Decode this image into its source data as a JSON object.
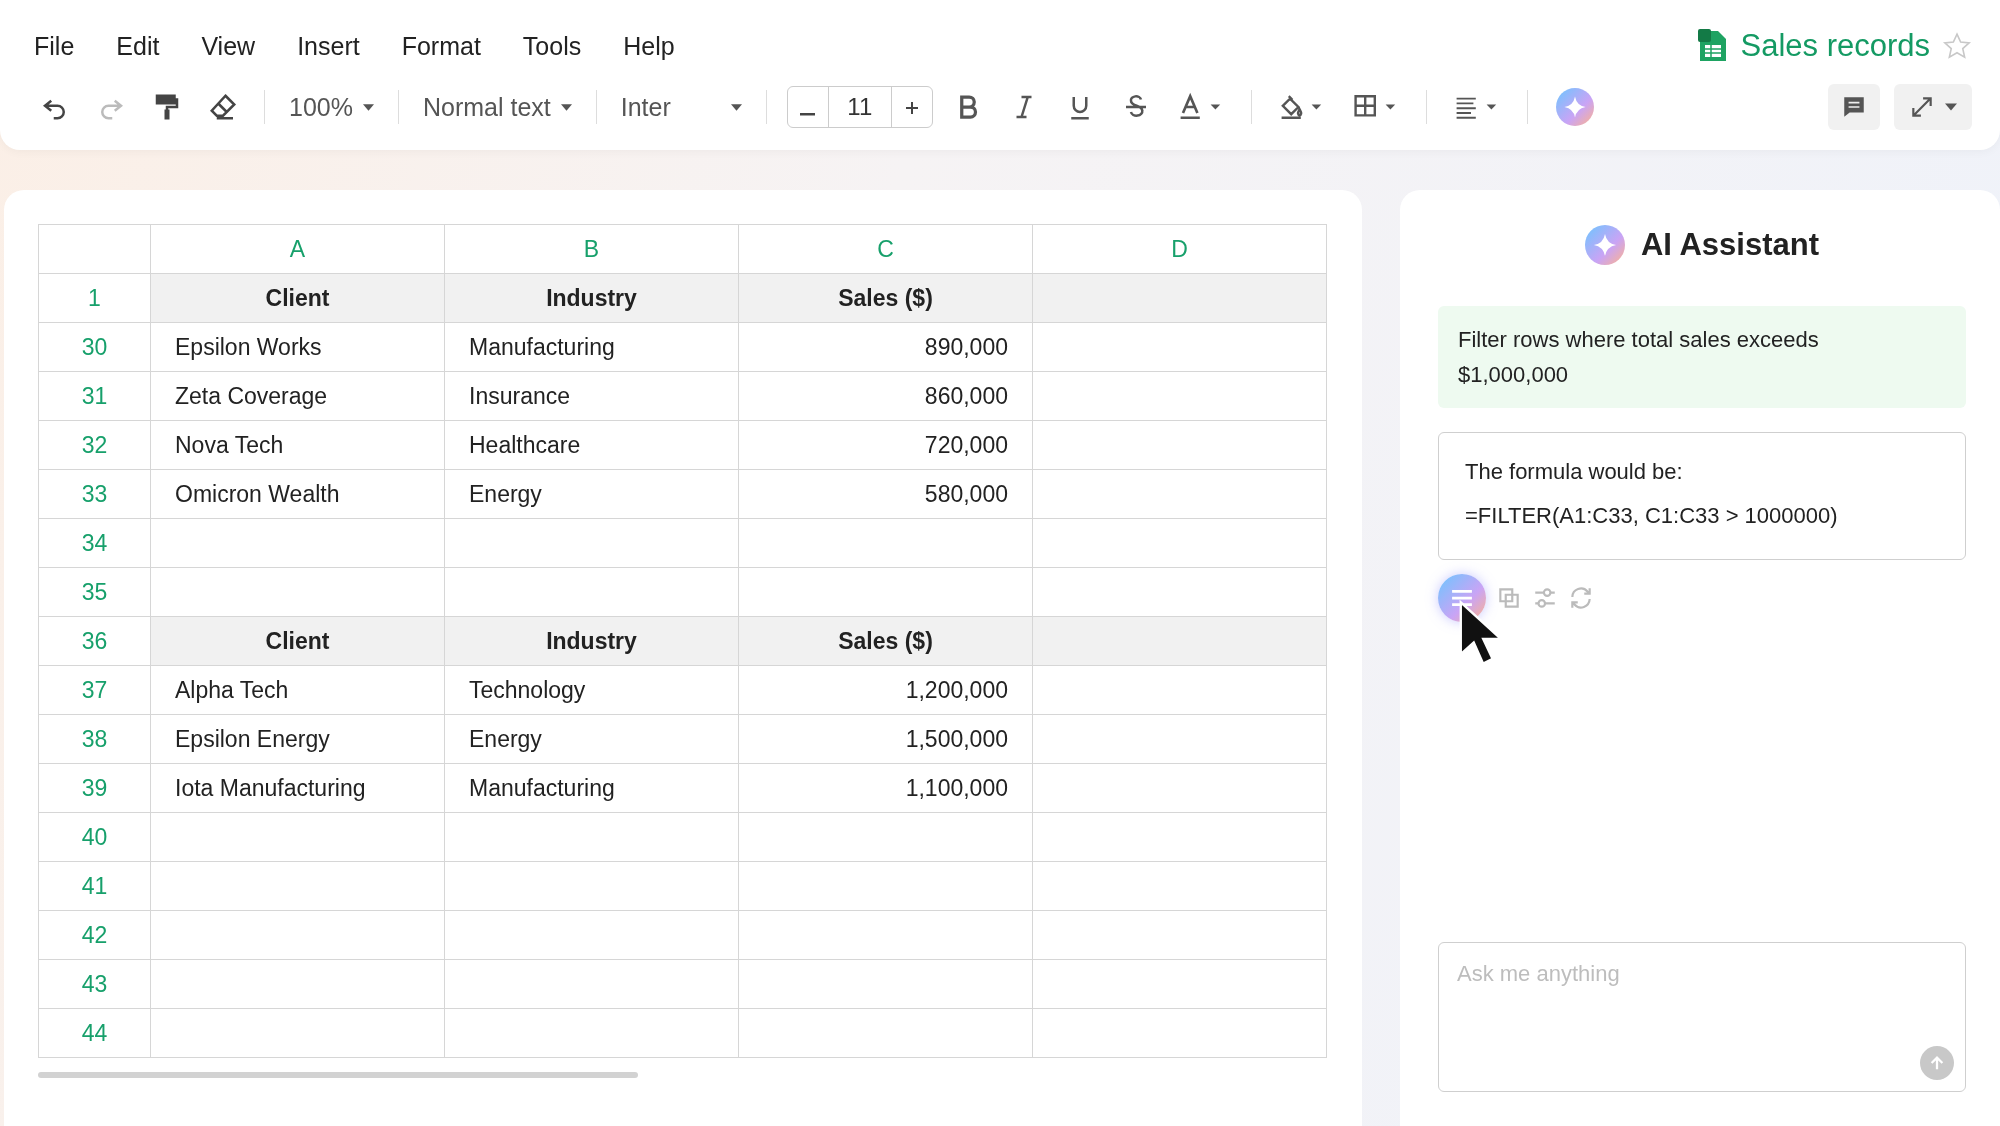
{
  "menu": [
    "File",
    "Edit",
    "View",
    "Insert",
    "Format",
    "Tools",
    "Help"
  ],
  "toolbar": {
    "zoom": "100%",
    "text_style": "Normal text",
    "font": "Inter",
    "font_size": "11"
  },
  "document": {
    "title": "Sales records",
    "starred": false
  },
  "sheet": {
    "columns": [
      "A",
      "B",
      "C",
      "D"
    ],
    "rows": [
      {
        "number": "1",
        "kind": "header",
        "cells": [
          "Client",
          "Industry",
          "Sales ($)"
        ]
      },
      {
        "number": "30",
        "kind": "data",
        "cells": [
          "Epsilon Works",
          "Manufacturing",
          "890,000"
        ]
      },
      {
        "number": "31",
        "kind": "data",
        "cells": [
          "Zeta Coverage",
          "Insurance",
          "860,000"
        ]
      },
      {
        "number": "32",
        "kind": "data",
        "cells": [
          "Nova Tech",
          "Healthcare",
          "720,000"
        ]
      },
      {
        "number": "33",
        "kind": "data",
        "cells": [
          "Omicron Wealth",
          "Energy",
          "580,000"
        ]
      },
      {
        "number": "34",
        "kind": "data",
        "cells": []
      },
      {
        "number": "35",
        "kind": "data",
        "cells": []
      },
      {
        "number": "36",
        "kind": "header",
        "cells": [
          "Client",
          "Industry",
          "Sales ($)"
        ]
      },
      {
        "number": "37",
        "kind": "data",
        "cells": [
          "Alpha Tech",
          "Technology",
          "1,200,000"
        ]
      },
      {
        "number": "38",
        "kind": "data",
        "cells": [
          "Epsilon Energy",
          "Energy",
          "1,500,000"
        ]
      },
      {
        "number": "39",
        "kind": "data",
        "cells": [
          "Iota Manufacturing",
          "Manufacturing",
          "1,100,000"
        ]
      },
      {
        "number": "40",
        "kind": "data",
        "cells": []
      },
      {
        "number": "41",
        "kind": "data",
        "cells": []
      },
      {
        "number": "42",
        "kind": "data",
        "cells": []
      },
      {
        "number": "43",
        "kind": "data",
        "cells": []
      },
      {
        "number": "44",
        "kind": "data",
        "cells": []
      }
    ]
  },
  "assistant": {
    "title": "AI Assistant",
    "user_message": "Filter rows where total sales exceeds $1,000,000",
    "reply_lines": [
      "The formula would be:",
      "=FILTER(A1:C33, C1:C33 > 1000000)"
    ],
    "input": {
      "placeholder": "Ask me anything"
    }
  }
}
